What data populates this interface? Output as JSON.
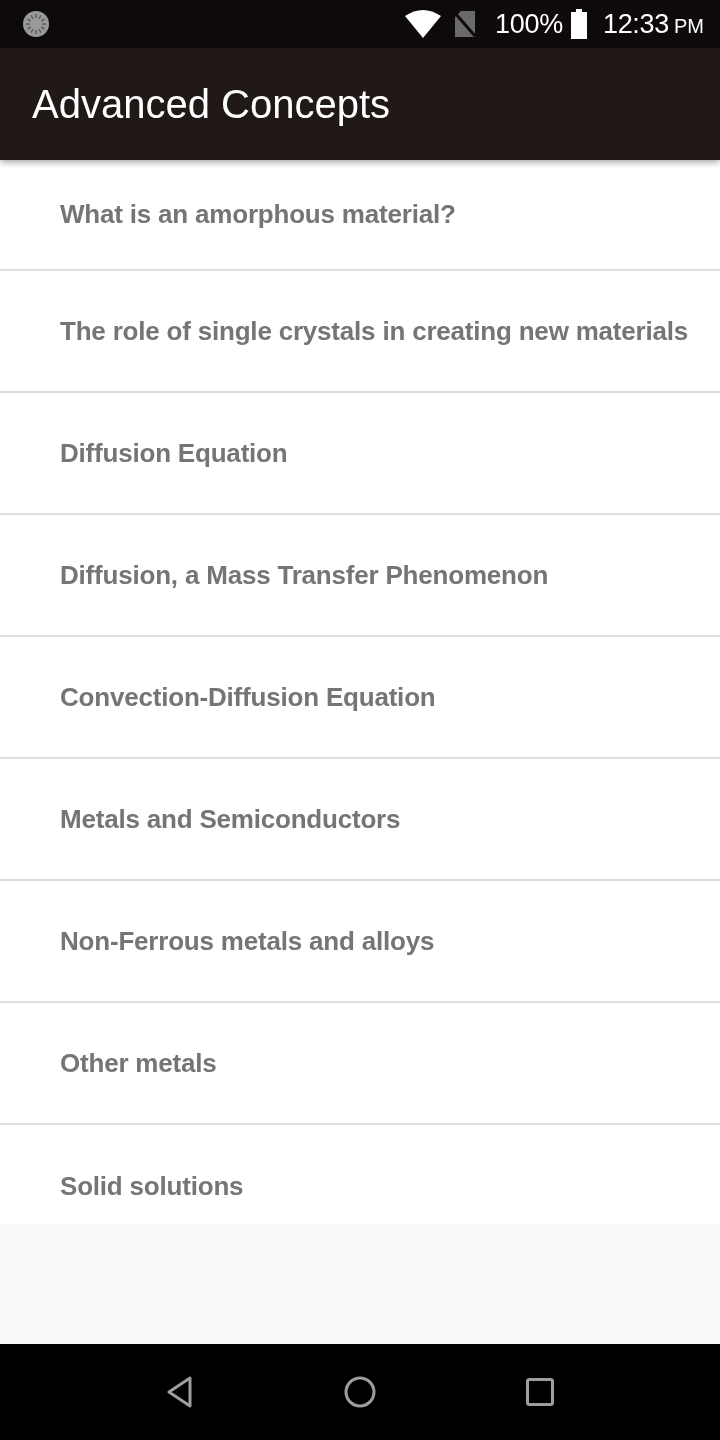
{
  "status_bar": {
    "battery": "100%",
    "time": "12:33",
    "meridiem": "PM"
  },
  "app_bar": {
    "title": "Advanced Concepts"
  },
  "topics": [
    "What is an amorphous material?",
    "The role of single crystals in creating new materials",
    "Diffusion Equation",
    "Diffusion, a Mass Transfer Phenomenon",
    "Convection-Diffusion Equation",
    "Metals and Semiconductors",
    "Non-Ferrous metals and alloys",
    "Other metals",
    "Solid solutions"
  ]
}
